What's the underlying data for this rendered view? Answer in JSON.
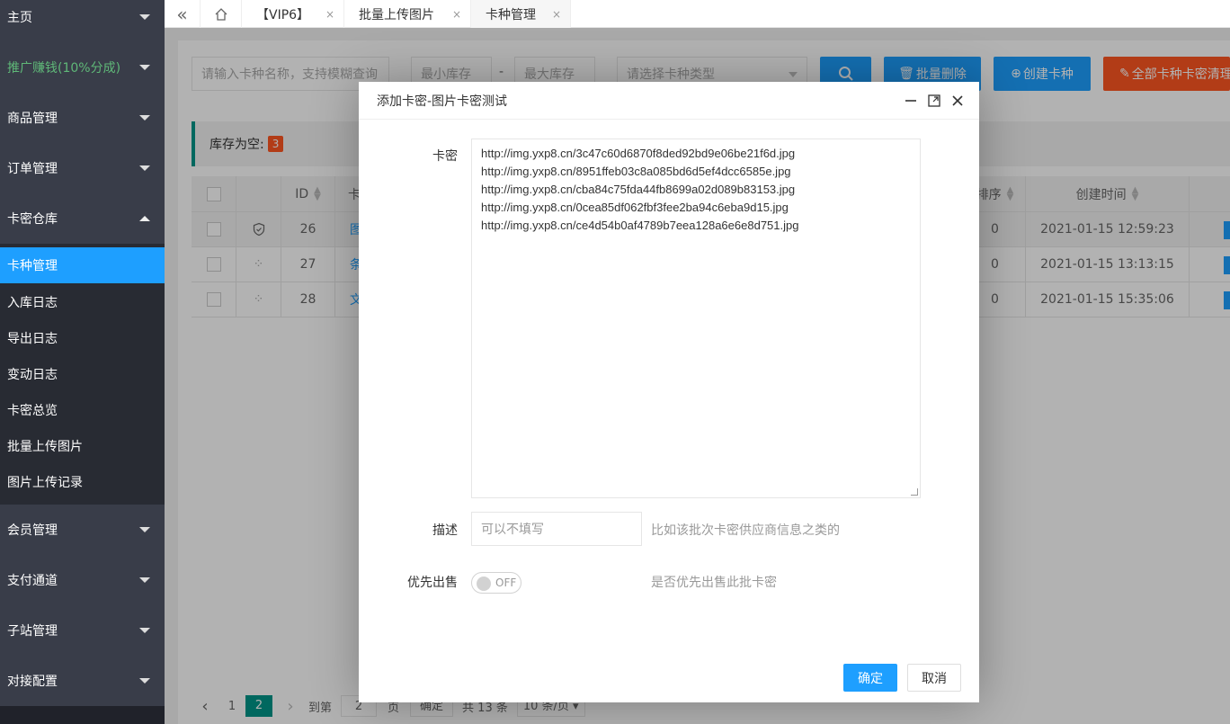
{
  "sidebar": {
    "items": [
      {
        "label": "主页"
      },
      {
        "label": "推广赚钱(10%分成)"
      },
      {
        "label": "商品管理"
      },
      {
        "label": "订单管理"
      },
      {
        "label": "卡密仓库"
      },
      {
        "label": "会员管理"
      },
      {
        "label": "支付通道"
      },
      {
        "label": "子站管理"
      },
      {
        "label": "对接配置"
      }
    ],
    "sub_items": [
      {
        "label": "卡种管理"
      },
      {
        "label": "入库日志"
      },
      {
        "label": "导出日志"
      },
      {
        "label": "变动日志"
      },
      {
        "label": "卡密总览"
      },
      {
        "label": "批量上传图片"
      },
      {
        "label": "图片上传记录"
      }
    ]
  },
  "tabs": {
    "collapse_icon": "«",
    "home_icon": "home-icon",
    "items": [
      {
        "label": "【VIP6】"
      },
      {
        "label": "批量上传图片"
      },
      {
        "label": "卡种管理"
      }
    ],
    "close": "×"
  },
  "toolbar": {
    "search_placeholder": "请输入卡种名称，支持模糊查询",
    "min_stock": "最小库存",
    "dash": "-",
    "max_stock": "最大库存",
    "type_placeholder": "请选择卡种类型",
    "batch_delete": "批量删除",
    "create": "创建卡种",
    "clear_all": "全部卡种卡密清理"
  },
  "notice": {
    "label": "库存为空:",
    "count": "3"
  },
  "table": {
    "headers": {
      "id": "ID",
      "name": "卡",
      "sort": "排序",
      "created": "创建时间"
    },
    "rows": [
      {
        "id": "26",
        "name": "图",
        "sort": "0",
        "created": "2021-01-15 12:59:23"
      },
      {
        "id": "27",
        "name": "条",
        "sort": "0",
        "created": "2021-01-15 13:13:15"
      },
      {
        "id": "28",
        "name": "文",
        "sort": "0",
        "created": "2021-01-15 15:35:06"
      }
    ]
  },
  "pager": {
    "prev": "‹",
    "page1": "1",
    "page2": "2",
    "next": "›",
    "goto": "到第",
    "goto_value": "2",
    "page_unit": "页",
    "confirm": "确定",
    "total": "共 13 条",
    "per_page": "10 条/页"
  },
  "dialog": {
    "title": "添加卡密-图片卡密测试",
    "card_label": "卡密",
    "card_lines": [
      "http://img.yxp8.cn/3c47c60d6870f8ded92bd9e06be21f6d.jpg",
      "http://img.yxp8.cn/8951ffeb03c8a085bd6d5ef4dcc6585e.jpg",
      "http://img.yxp8.cn/cba84c75fda44fb8699a02d089b83153.jpg",
      "http://img.yxp8.cn/0cea85df062fbf3fee2ba94c6eba9d15.jpg",
      "http://img.yxp8.cn/ce4d54b0af4789b7eea128a6e6e8d751.jpg"
    ],
    "desc_label": "描述",
    "desc_placeholder": "可以不填写",
    "desc_hint": "比如该批次卡密供应商信息之类的",
    "priority_label": "优先出售",
    "switch_text": "OFF",
    "priority_hint": "是否优先出售此批卡密",
    "ok": "确定",
    "cancel": "取消"
  },
  "colors": {
    "accent": "#1e9fff",
    "danger": "#ff5722",
    "sidebar": "#393d49",
    "promo": "#5fb878"
  }
}
